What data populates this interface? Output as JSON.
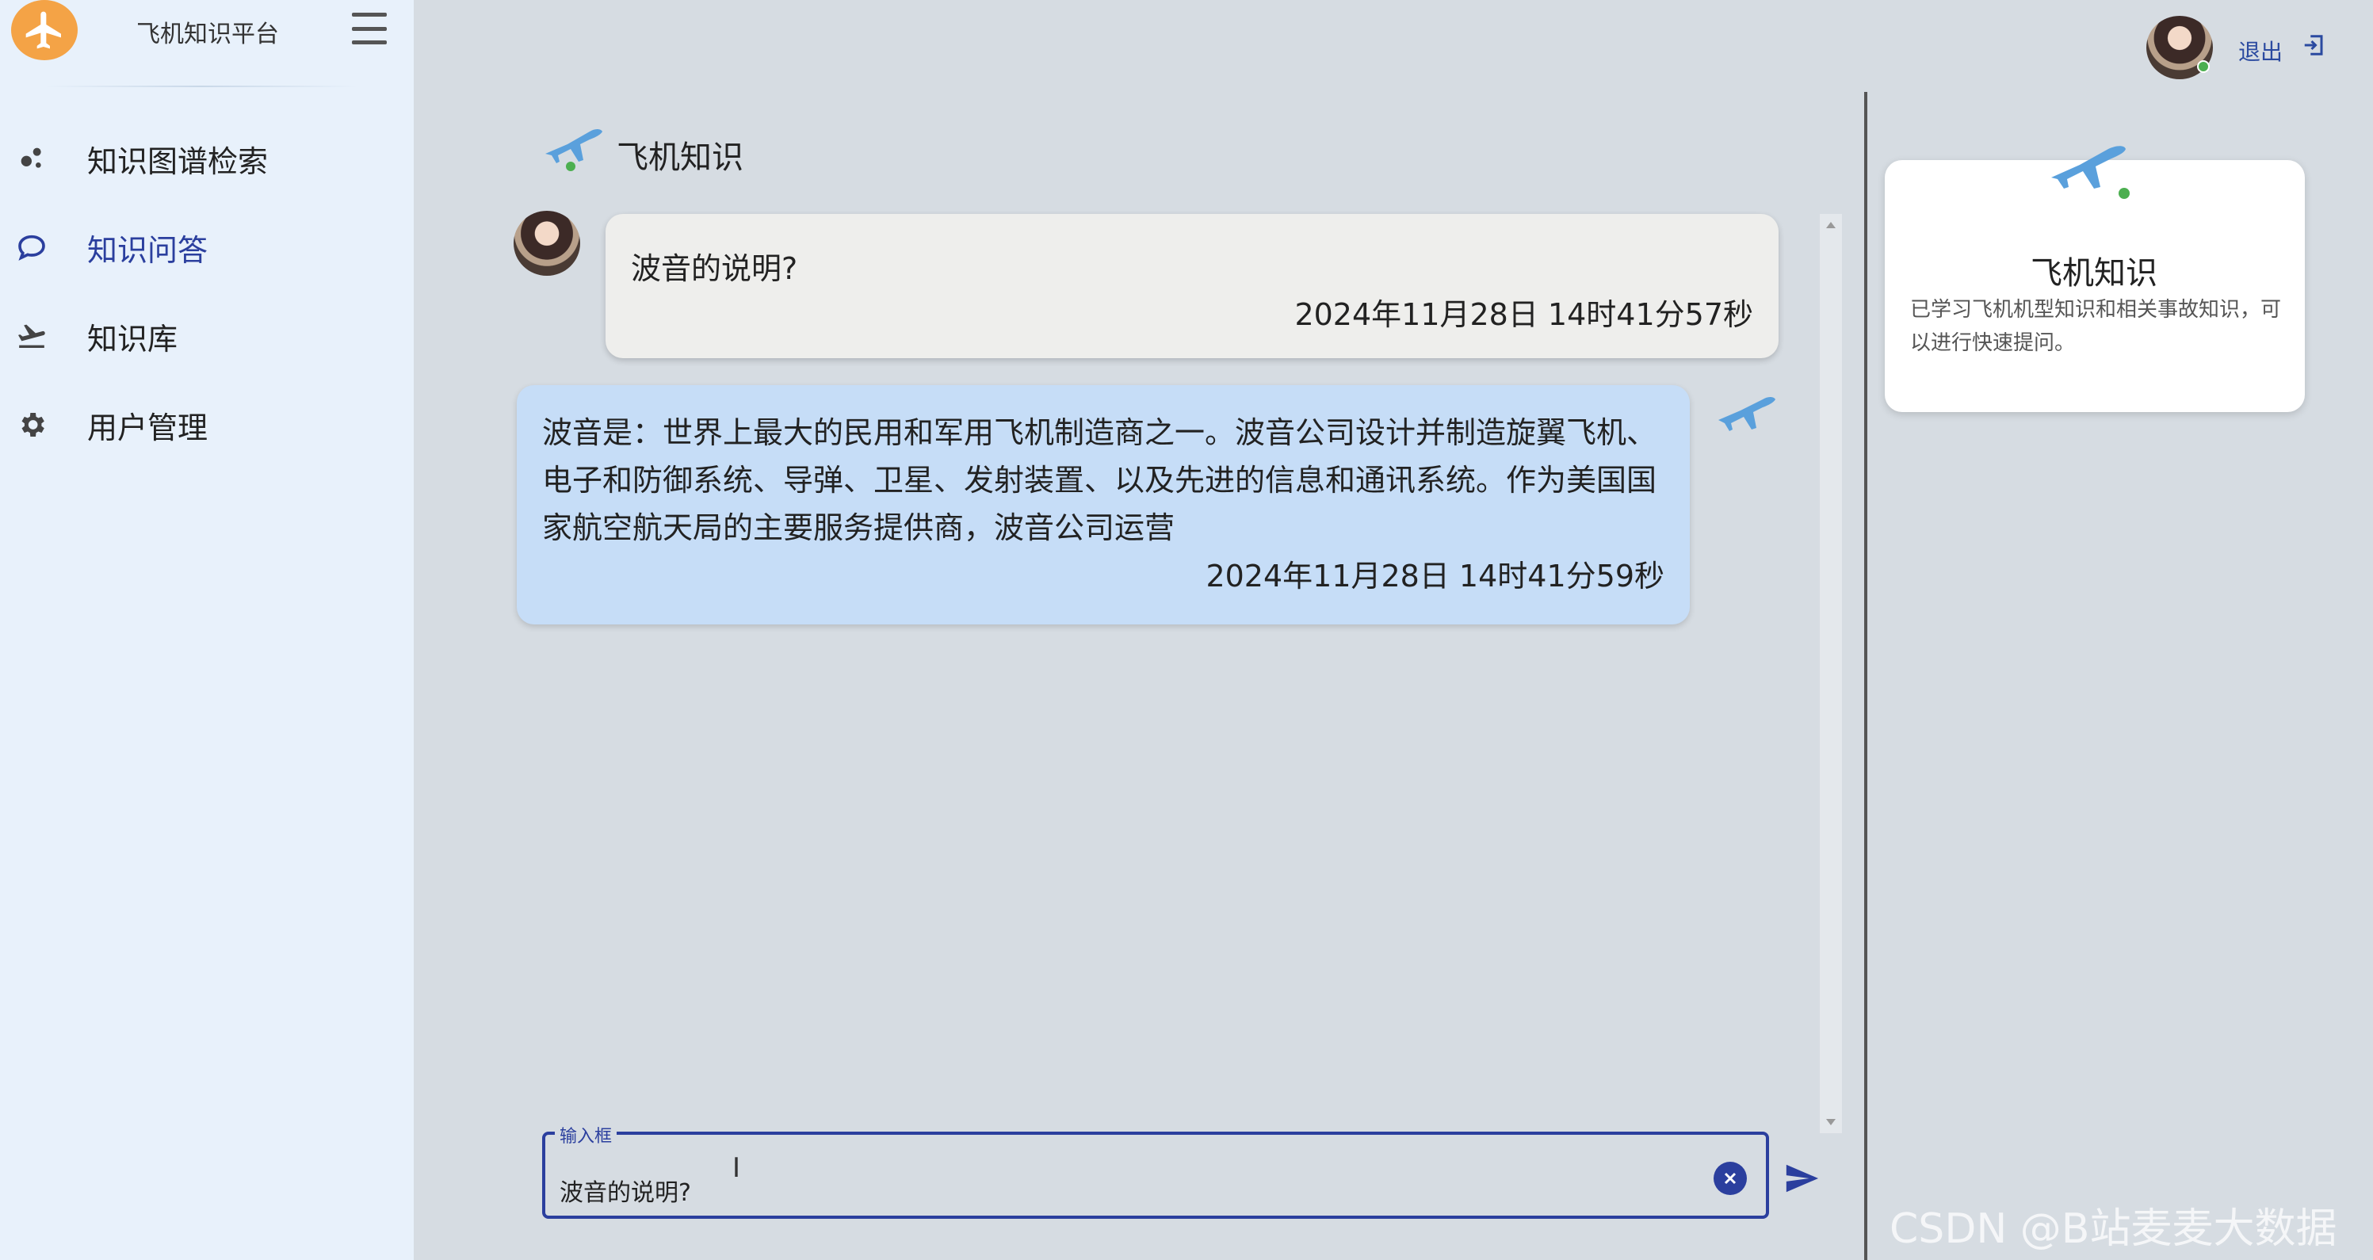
{
  "sidebar": {
    "brand": "飞机知识平台",
    "items": [
      {
        "label": "知识图谱检索",
        "icon": "graph-icon"
      },
      {
        "label": "知识问答",
        "icon": "chat-bubble-icon"
      },
      {
        "label": "知识库",
        "icon": "airplane-icon"
      },
      {
        "label": "用户管理",
        "icon": "gear-icon"
      }
    ],
    "active_index": 1
  },
  "header": {
    "logout_label": "退出"
  },
  "chat": {
    "title": "飞机知识",
    "messages": [
      {
        "role": "user",
        "text": "波音的说明?",
        "time": "2024年11月28日 14时41分57秒"
      },
      {
        "role": "bot",
        "text": "波音是：世界上最大的民用和军用飞机制造商之一。波音公司设计并制造旋翼飞机、电子和防御系统、导弹、卫星、发射装置、以及先进的信息和通讯系统。作为美国国家航空航天局的主要服务提供商，波音公司运营",
        "time": "2024年11月28日 14时41分59秒"
      }
    ],
    "input": {
      "label": "输入框",
      "value": "波音的说明?"
    }
  },
  "panel": {
    "title": "飞机知识",
    "description": "已学习飞机机型知识和相关事故知识，可以进行快速提问。"
  },
  "watermark": "CSDN @B站麦麦大数据",
  "colors": {
    "accent": "#2b3f9e",
    "logo": "#f4a346",
    "bot_bubble": "#c6ddf7",
    "user_bubble": "#eeeeec"
  }
}
